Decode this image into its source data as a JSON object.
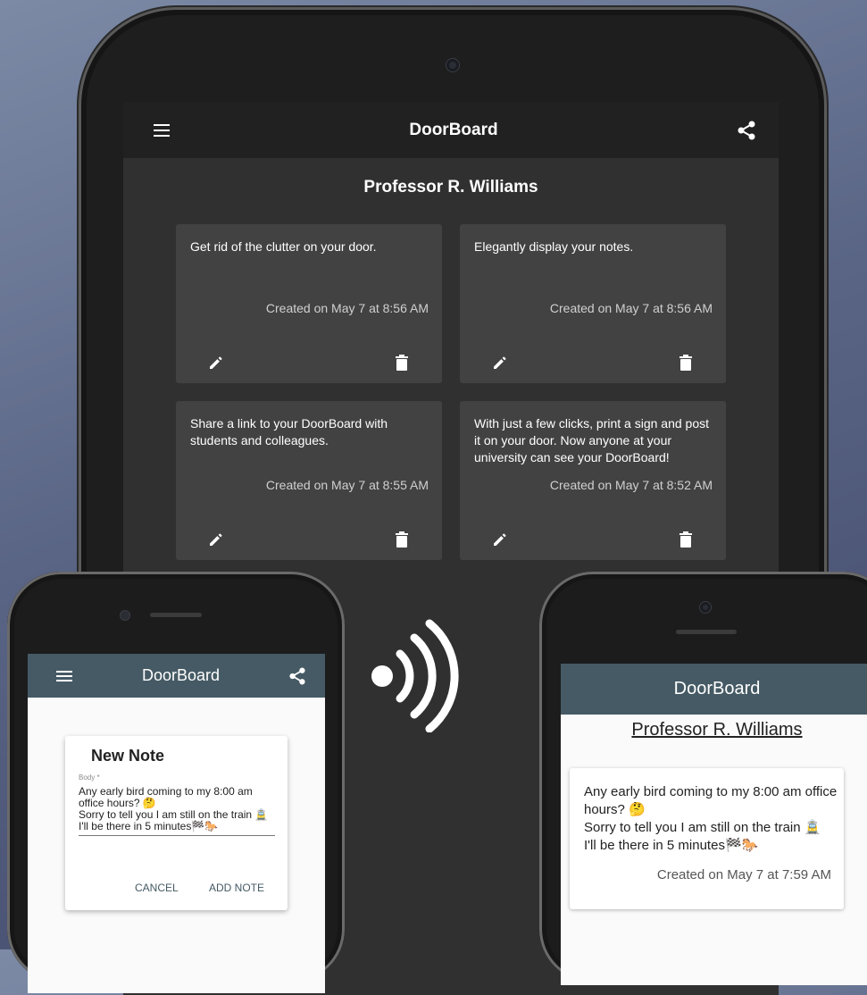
{
  "tablet": {
    "app_title": "DoorBoard",
    "owner": "Professor R. Williams",
    "menu_icon": "menu-icon",
    "share_icon": "share-icon",
    "notes": [
      {
        "body": "Get rid of the clutter on your door.",
        "date": "Created on May 7 at 8:56 AM"
      },
      {
        "body": "Elegantly display your notes.",
        "date": "Created on May 7 at 8:56 AM"
      },
      {
        "body": "Share a link to your DoorBoard with students and colleagues.",
        "date": "Created on May 7 at 8:55 AM"
      },
      {
        "body": "With just a few clicks, print a sign and post it on your door. Now anyone at your university can see your DoorBoard!",
        "date": "Created on May 7 at 8:52 AM"
      }
    ]
  },
  "phone_left": {
    "app_title": "DoorBoard",
    "dialog": {
      "title": "New Note",
      "field_label": "Body *",
      "field_value": "Any early bird coming to my 8:00 am office hours? 🤔\nSorry to tell you I am still on the train 🚊\nI'll be there in 5 minutes🏁🐎",
      "cancel_label": "CANCEL",
      "add_label": "ADD NOTE"
    }
  },
  "phone_right": {
    "app_title": "DoorBoard",
    "owner": "Professor R. Williams",
    "note": {
      "body": "Any early bird coming to my 8:00 am office hours? 🤔\nSorry to tell you I am still on the train 🚊\nI'll be there in 5 minutes🏁🐎",
      "date": "Created on May 7 at 7:59 AM"
    }
  },
  "colors": {
    "phone_bar": "#455a64",
    "tablet_bar": "#212121",
    "tablet_bg": "#303030",
    "card": "#424242"
  }
}
